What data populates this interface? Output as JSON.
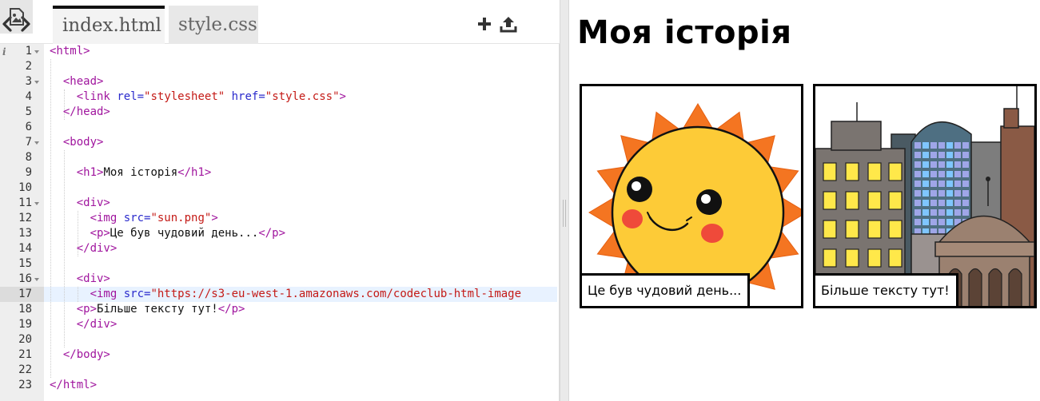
{
  "editor": {
    "tabs": [
      {
        "label": "index.html",
        "active": true
      },
      {
        "label": "style.css",
        "active": false
      }
    ],
    "toolbar": {
      "back_icon": "chevron-left-icon",
      "forward_icon": "chevron-right-icon",
      "add_icon": "plus-icon",
      "upload_icon": "upload-icon",
      "image_icon": "image-icon"
    },
    "info_mark": "i",
    "active_line": 17,
    "line_numbers": [
      "1",
      "2",
      "3",
      "4",
      "5",
      "6",
      "7",
      "8",
      "9",
      "10",
      "11",
      "12",
      "13",
      "14",
      "15",
      "16",
      "17",
      "18",
      "19",
      "20",
      "21",
      "22",
      "23"
    ],
    "code_lines": {
      "l1": {
        "open": "<html>"
      },
      "l3": {
        "open": "<head>"
      },
      "l4": {
        "tag": "<link",
        "attr1": "rel=",
        "val1": "\"stylesheet\"",
        "attr2": "href=",
        "val2": "\"style.css\"",
        "close": ">"
      },
      "l5": {
        "open": "</head>"
      },
      "l7": {
        "open": "<body>"
      },
      "l9": {
        "open": "<h1>",
        "text": "Моя історія",
        "close": "</h1>"
      },
      "l11": {
        "open": "<div>"
      },
      "l12": {
        "tag": "<img",
        "attr": "src=",
        "val": "\"sun.png\"",
        "close": ">"
      },
      "l13": {
        "open": "<p>",
        "text": "Це був чудовий день...",
        "close": "</p>"
      },
      "l14": {
        "open": "</div>"
      },
      "l16": {
        "open": "<div>"
      },
      "l17": {
        "tag": "<img",
        "attr": "src=",
        "val": "\"https://s3-eu-west-1.amazonaws.com/codeclub-html-image"
      },
      "l18": {
        "open": "<p>",
        "text": "Більше тексту тут!",
        "close": "</p>"
      },
      "l19": {
        "open": "</div>"
      },
      "l21": {
        "open": "</body>"
      },
      "l23": {
        "open": "</html>"
      }
    }
  },
  "preview": {
    "title": "Моя історія",
    "panels": [
      {
        "image": "sun-illustration",
        "caption": "Це був чудовий день..."
      },
      {
        "image": "city-illustration",
        "caption": "Більше тексту тут!"
      }
    ]
  },
  "colors": {
    "tag": "#a0159e",
    "attribute": "#2a2acc",
    "string": "#c41a16",
    "active_line": "#e8f2ff",
    "sun_body": "#fdcb37",
    "sun_rays": "#f47521"
  }
}
